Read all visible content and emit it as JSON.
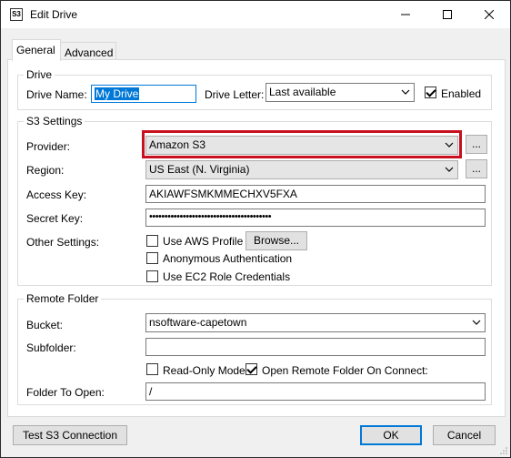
{
  "window": {
    "title": "Edit Drive",
    "icon_text": "S3"
  },
  "tabs": [
    {
      "label": "General"
    },
    {
      "label": "Advanced"
    }
  ],
  "drive": {
    "group_label": "Drive",
    "name_label": "Drive Name:",
    "name_value": "My Drive",
    "letter_label": "Drive Letter:",
    "letter_value": "Last available",
    "enabled_label": "Enabled",
    "enabled_checked": true
  },
  "s3": {
    "group_label": "S3 Settings",
    "provider_label": "Provider:",
    "provider_value": "Amazon S3",
    "provider_more": "...",
    "region_label": "Region:",
    "region_value": "US East (N. Virginia)",
    "region_more": "...",
    "access_key_label": "Access Key:",
    "access_key_value": "AKIAWFSMKMMECHXV5FXA",
    "secret_key_label": "Secret Key:",
    "secret_key_value": "••••••••••••••••••••••••••••••••••••••••",
    "other_label": "Other Settings:",
    "use_aws_profile_label": "Use AWS Profile",
    "browse_label": "Browse...",
    "anonymous_label": "Anonymous Authentication",
    "ec2_label": "Use EC2 Role Credentials"
  },
  "remote": {
    "group_label": "Remote Folder",
    "bucket_label": "Bucket:",
    "bucket_value": "nsoftware-capetown",
    "subfolder_label": "Subfolder:",
    "subfolder_value": "",
    "readonly_label": "Read-Only Mode",
    "open_on_connect_label": "Open Remote Folder On Connect:",
    "open_on_connect_checked": true,
    "folder_open_label": "Folder To Open:",
    "folder_open_value": "/"
  },
  "buttons": {
    "test": "Test S3 Connection",
    "ok": "OK",
    "cancel": "Cancel"
  },
  "colors": {
    "highlight": "#c8101f",
    "accent": "#0078d7"
  }
}
